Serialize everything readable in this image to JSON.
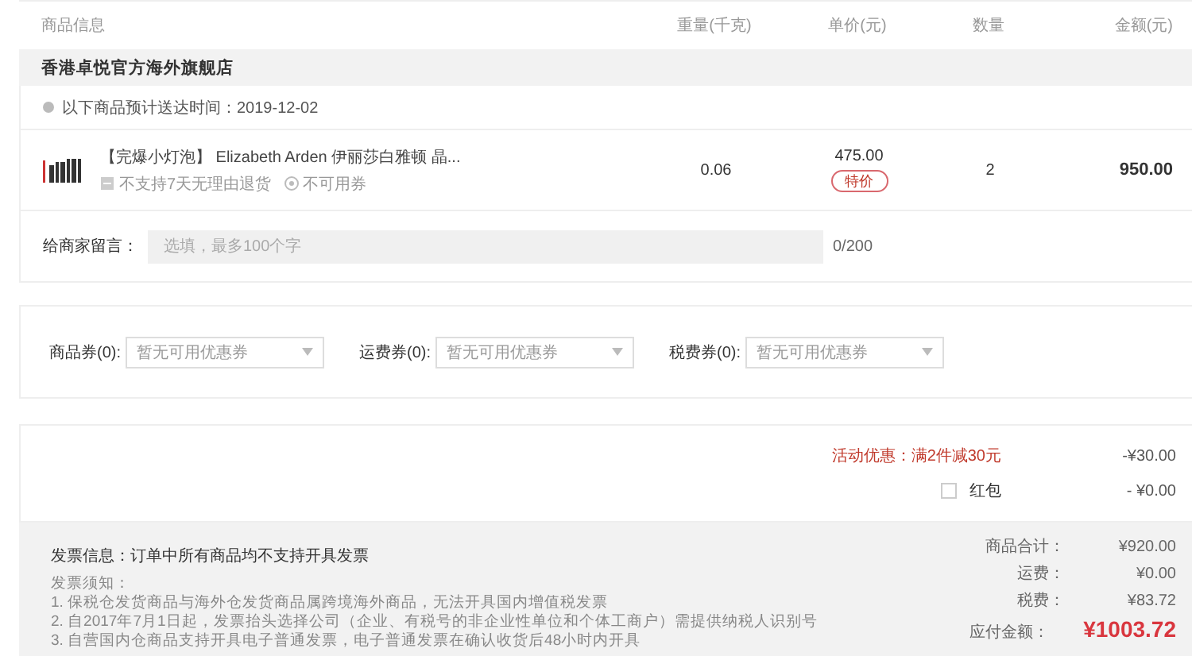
{
  "header": {
    "columns": [
      "商品信息",
      "重量(千克)",
      "单价(元)",
      "数量",
      "金额(元)"
    ]
  },
  "store": {
    "name": "香港卓悦官方海外旗舰店"
  },
  "delivery": {
    "text": "以下商品预计送达时间：2019-12-02"
  },
  "items": [
    {
      "title": "【完爆小灯泡】 Elizabeth Arden 伊丽莎白雅顿 晶...",
      "tags": [
        "不支持7天无理由退货",
        "不可用券"
      ],
      "weight": "0.06",
      "price": "475.00",
      "badge": "特价",
      "quantity": "2",
      "amount": "950.00"
    }
  ],
  "message": {
    "label": "给商家留言：",
    "placeholder": "选填，最多100个字",
    "counter": "0/200"
  },
  "coupons": [
    {
      "label": "商品券(0):",
      "placeholder": "暂无可用优惠券"
    },
    {
      "label": "运费券(0):",
      "placeholder": "暂无可用优惠券"
    },
    {
      "label": "税费券(0):",
      "placeholder": "暂无可用优惠券"
    }
  ],
  "discounts": [
    {
      "kind": "promo",
      "label": "活动优惠：满2件减30元",
      "value": "-¥30.00"
    },
    {
      "kind": "checkbox",
      "label": "红包",
      "checked": false,
      "value": "- ¥0.00"
    }
  ],
  "invoice": {
    "info": "发票信息：订单中所有商品均不支持开具发票",
    "notes_title": "发票须知：",
    "notes": [
      "1. 保税仓发货商品与海外仓发货商品属跨境海外商品，无法开具国内增值税发票",
      "2. 自2017年7月1日起，发票抬头选择公司（企业、有税号的非企业性单位和个体工商户）需提供纳税人识别号",
      "3. 自营国内仓商品支持开具电子普通发票，电子普通发票在确认收货后48小时内开具"
    ]
  },
  "totals": [
    {
      "kind": "plain",
      "label": "商品合计：",
      "value": "¥920.00"
    },
    {
      "kind": "plain",
      "label": "运费：",
      "value": "¥0.00"
    },
    {
      "kind": "plain",
      "label": "税费：",
      "value": "¥83.72"
    },
    {
      "kind": "grand",
      "label": "应付金额：",
      "value": "¥1003.72"
    }
  ]
}
